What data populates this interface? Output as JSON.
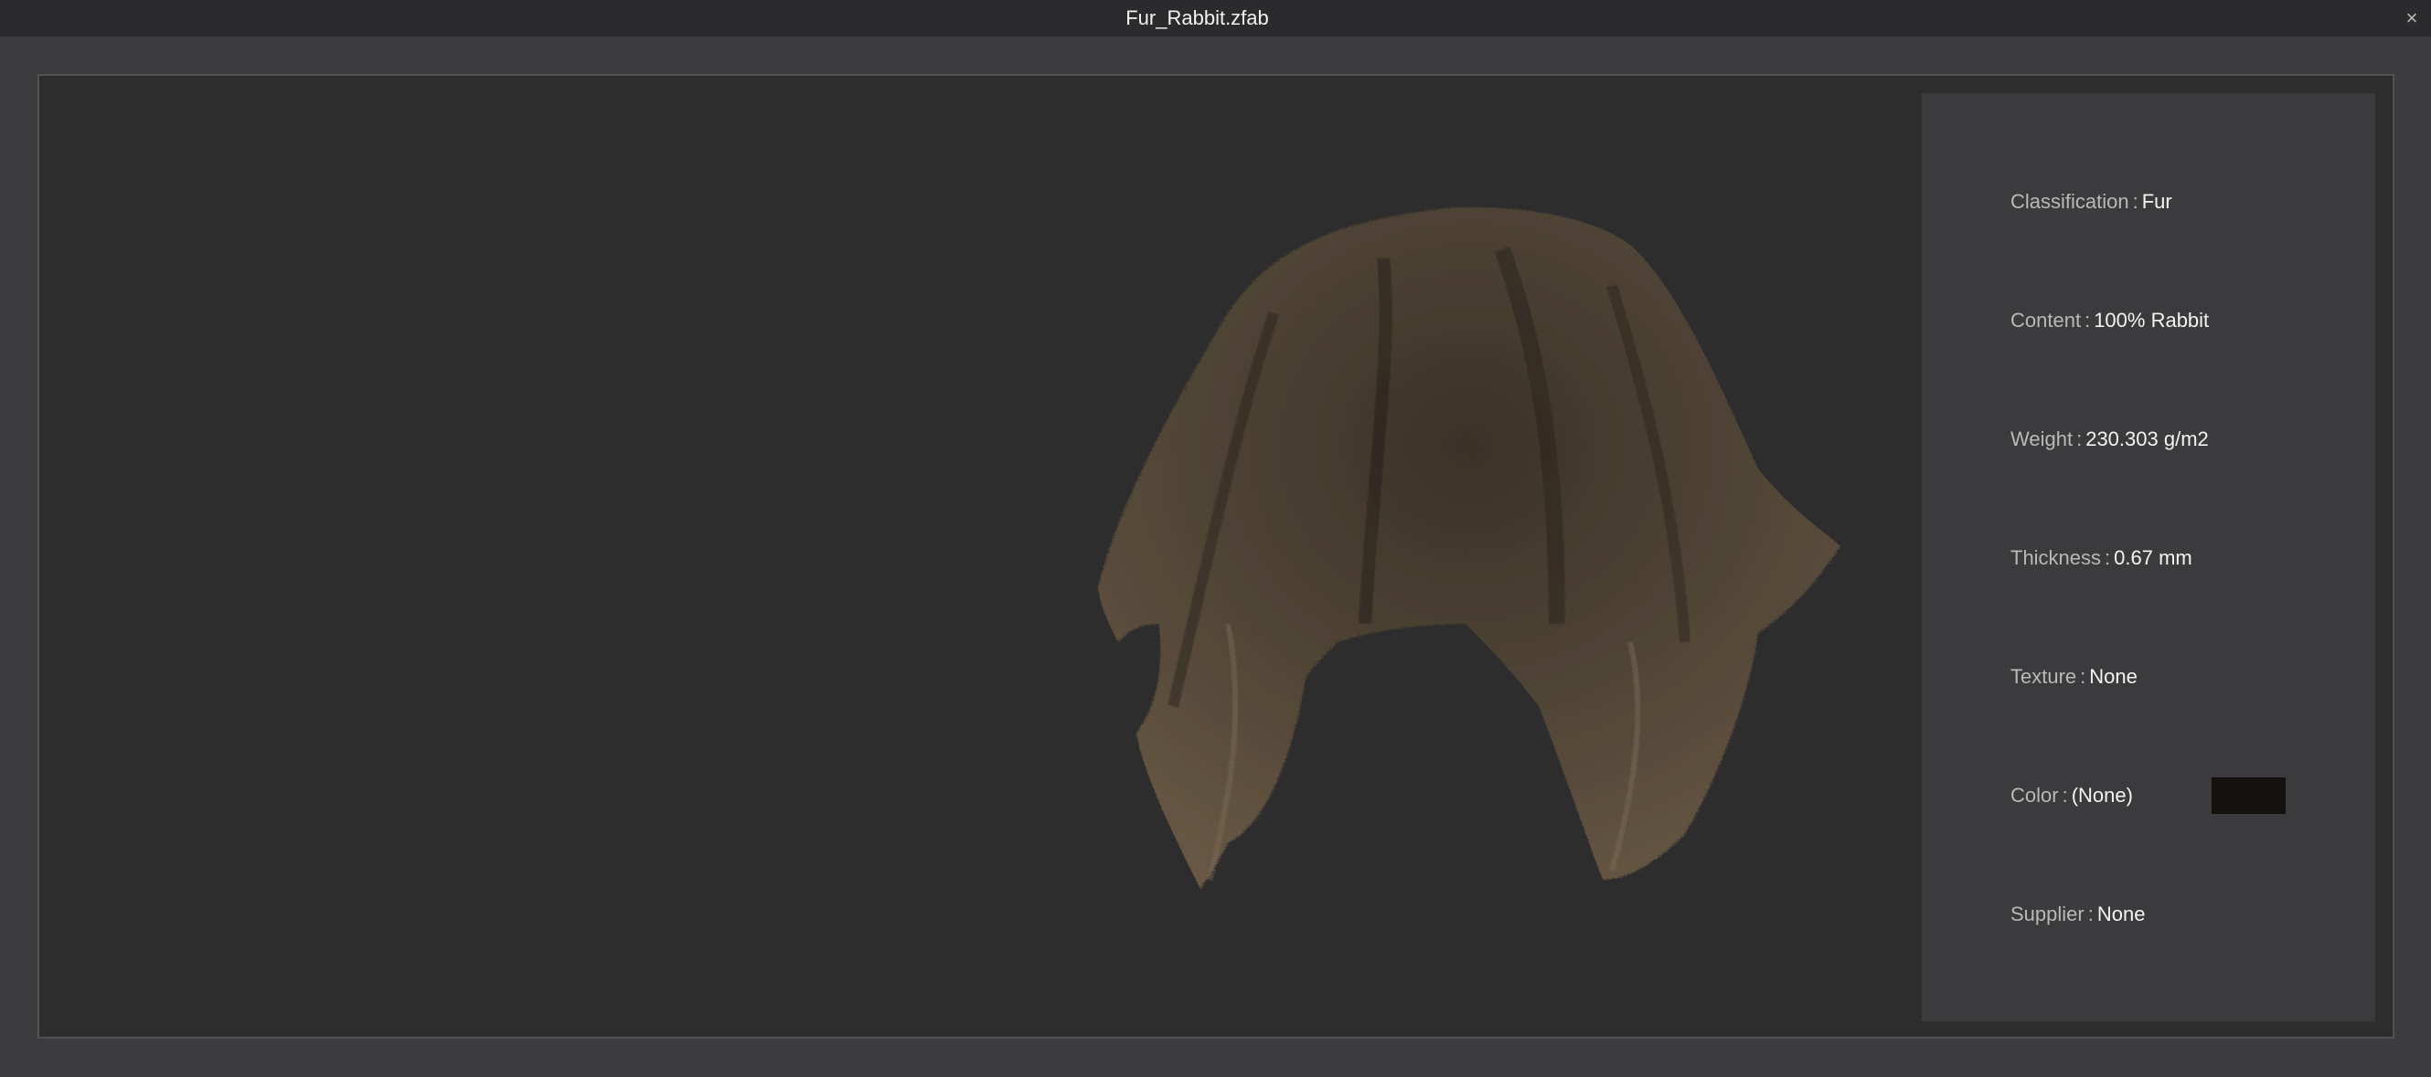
{
  "window": {
    "title": "Fur_Rabbit.zfab",
    "close_glyph": "×"
  },
  "preview": {
    "subject": "fur fabric draped over sphere"
  },
  "info": {
    "separator": ":",
    "fields": [
      {
        "label": "Classification",
        "value": "Fur"
      },
      {
        "label": "Content",
        "value": "100% Rabbit"
      },
      {
        "label": "Weight",
        "value": "230.303 g/m2"
      },
      {
        "label": "Thickness",
        "value": "0.67 mm"
      },
      {
        "label": "Texture",
        "value": "None"
      },
      {
        "label": "Color",
        "value": "(None)"
      },
      {
        "label": "Supplier",
        "value": "None"
      }
    ],
    "color_swatch": "#14110f"
  },
  "colors": {
    "window_bg": "#3c3c3e",
    "titlebar": "#2b2b2d",
    "viewport": "#2d2d2d",
    "panel": "#3b3b3d",
    "fabric": "#4e4336"
  }
}
